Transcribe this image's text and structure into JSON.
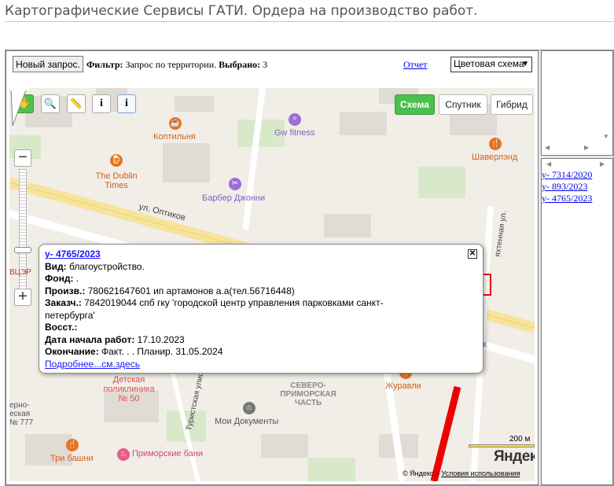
{
  "header": {
    "title": "Картографические Сервисы ГАТИ. Ордера на производство работ."
  },
  "toolbar": {
    "new_request": "Новый запрос.",
    "filter_label": "Фильтр:",
    "filter_value": "Запрос по территории.",
    "selected_label": "Выбрано:",
    "selected_count": "3",
    "report_link": "Отчет",
    "color_scheme": "Цветовая схема"
  },
  "map": {
    "tools": [
      {
        "name": "hand",
        "icon": "hand-icon",
        "active": true
      },
      {
        "name": "zoom-area",
        "icon": "magnifier-icon"
      },
      {
        "name": "ruler",
        "icon": "ruler-icon"
      },
      {
        "name": "info",
        "label": "i"
      },
      {
        "name": "info2",
        "label": "i"
      }
    ],
    "map_types": {
      "scheme": "Схема",
      "satellite": "Спутник",
      "hybrid": "Гибрид"
    },
    "pois": {
      "koptilnya": "Коптильня",
      "gw_fitness": "Gw fitness",
      "dublin_1": "The Dublin",
      "dublin_2": "Times",
      "barber": "Барбер Джонни",
      "shaverlend": "Шаверлэнд",
      "clinic_1": "Детская",
      "clinic_2": "поликлиника",
      "clinic_3": "№ 50",
      "district_1": "СЕВЕРО-",
      "district_2": "ПРИМОРСКАЯ",
      "district_3": "ЧАСТЬ",
      "zhuravli": "Журавли",
      "moi_docs": "Мои Документы",
      "tri_bashni": "Три башни",
      "primorskie": "Приморские бани",
      "school_1": "ерно-",
      "school_2": "еская",
      "school_3": "№ 777",
      "vcer": "ВЦЭР",
      "ok": "ок"
    },
    "streets": {
      "optikov": "ул. Оптиков",
      "turistskaya": "Туристская улица",
      "yakhtennaya": "яхтенная ул."
    },
    "scale": "200 м",
    "logo": "Яндекс",
    "copyright": "© Яндекс –",
    "terms": "Условия использования"
  },
  "popup": {
    "order_link": "у- 4765/2023",
    "type_label": "Вид:",
    "type_value": "благоустройство.",
    "fund_label": "Фонд:",
    "fund_value": ".",
    "producer_label": "Произв.:",
    "producer_value": "780621647601 ип артамонов а.а(тел.56716448)",
    "customer_label": "Заказч.:",
    "customer_value_1": "7842019044 спб гку 'городской центр управления парковками санкт-",
    "customer_value_2": "петербурга'",
    "restore_label": "Восст.:",
    "start_label": "Дата начала работ:",
    "start_value": "17.10.2023",
    "end_label": "Окончание:",
    "end_value": "Факт. . . Планир. 31.05.2024",
    "more_link": "Подробнее...см.здесь"
  },
  "orders": [
    "у- 7314/2020",
    "у- 893/2023",
    "у- 4765/2023"
  ],
  "colors": {
    "scheme_active": "#4cbf4c",
    "link": "#1a1aff",
    "poi_orange": "#e8721c",
    "poi_purple": "#9a6fd6",
    "poi_pink": "#e85a8a"
  }
}
